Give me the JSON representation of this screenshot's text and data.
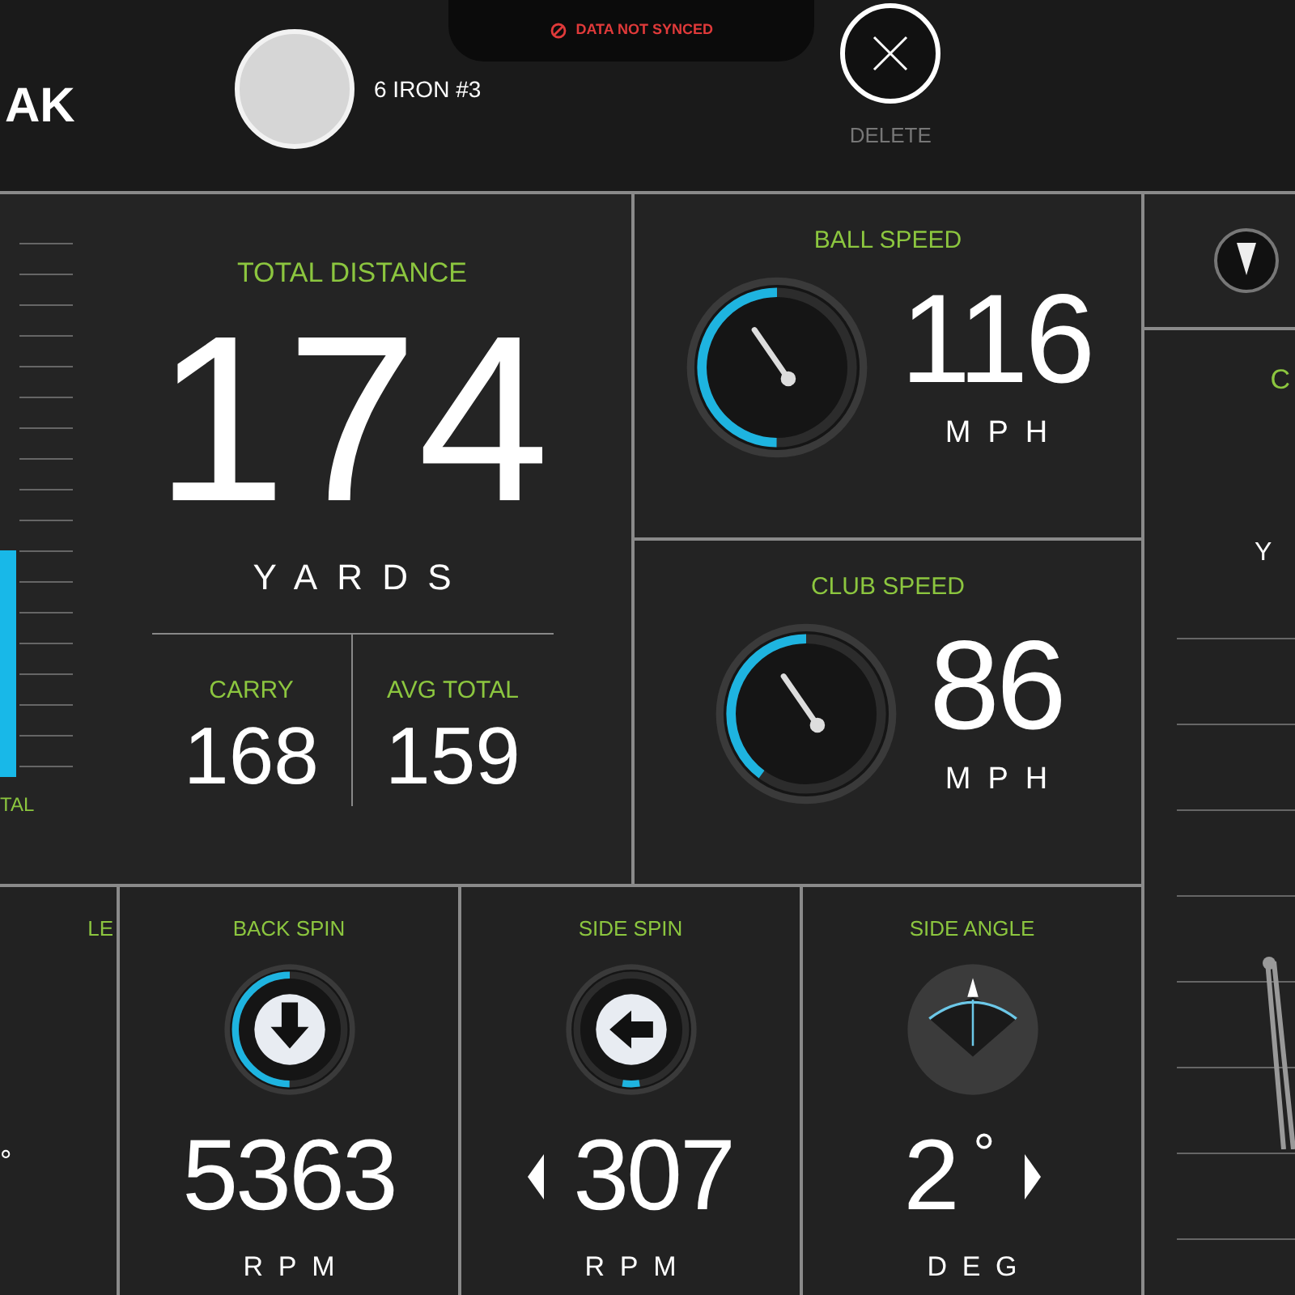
{
  "header": {
    "logo_text": "AK",
    "club_name": "6 IRON #3",
    "sync_status": "DATA NOT SYNCED",
    "delete_label": "DELETE"
  },
  "distance_panel": {
    "chart_label": "TAL",
    "title": "TOTAL DISTANCE",
    "value": "174",
    "unit": "YARDS",
    "sub_stats": [
      {
        "label": "CARRY",
        "value": "168"
      },
      {
        "label": "AVG TOTAL",
        "value": "159"
      }
    ]
  },
  "speed_panels": [
    {
      "title": "BALL SPEED",
      "value": "116",
      "unit": "MPH",
      "level": 0.5
    },
    {
      "title": "CLUB SPEED",
      "value": "86",
      "unit": "MPH",
      "level": 0.4
    }
  ],
  "right_panel": {
    "title": "C",
    "unit": "Y"
  },
  "bottom_panels": [
    {
      "kind": "partial",
      "title": "LE",
      "value": "°"
    },
    {
      "kind": "back_spin",
      "title": "BACK SPIN",
      "value": "5363",
      "unit": "RPM",
      "level": 0.5
    },
    {
      "kind": "side_spin",
      "title": "SIDE SPIN",
      "value": "307",
      "unit": "RPM",
      "level": 0.05
    },
    {
      "kind": "angle",
      "title": "SIDE ANGLE",
      "value": "2",
      "degree": "°",
      "unit": "DEG"
    }
  ]
}
